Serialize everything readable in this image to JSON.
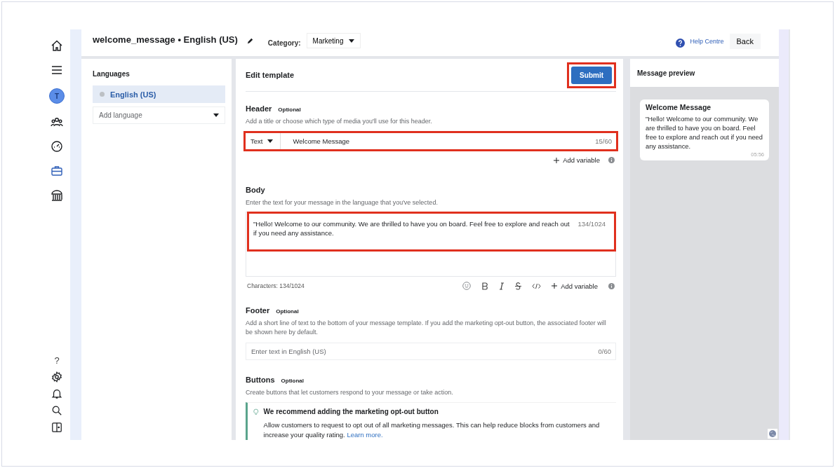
{
  "nav": {
    "top": [
      {
        "kind": "home",
        "selected": false
      },
      {
        "kind": "menu",
        "selected": false
      },
      {
        "kind": "avatar",
        "label": "T",
        "selected": false
      },
      {
        "kind": "people",
        "selected": false
      },
      {
        "kind": "gauge",
        "selected": false
      },
      {
        "kind": "briefcase",
        "selected": true
      },
      {
        "kind": "bank",
        "selected": false
      }
    ],
    "bottom": [
      {
        "kind": "help",
        "label": "?"
      },
      {
        "kind": "gear"
      },
      {
        "kind": "bell"
      },
      {
        "kind": "search"
      },
      {
        "kind": "panel"
      }
    ]
  },
  "header": {
    "title": "welcome_message • English (US)",
    "category_label": "Category:",
    "category_value": "Marketing",
    "help_link": "Help Centre",
    "back_button": "Back"
  },
  "languages": {
    "title": "Languages",
    "items": [
      {
        "label": "English (US)",
        "selected": true
      }
    ],
    "add_language": {
      "placeholder": "Add language"
    }
  },
  "editor": {
    "title": "Edit template",
    "submit": {
      "label": "Submit",
      "highlighted": true
    },
    "header_section": {
      "title": "Header",
      "optional": "Optional",
      "description": "Add a title or choose which type of media you'll use for this header.",
      "type_select": "Text",
      "value": "Welcome Message",
      "counter": "15/60",
      "highlighted": true,
      "add_variable": "Add variable"
    },
    "body_section": {
      "title": "Body",
      "description": "Enter the text for your message in the language that you've selected.",
      "value": "\"Hello! Welcome to our community. We are thrilled to have you on board. Feel free to explore and reach out if you need any assistance.",
      "counter": "134/1024",
      "highlighted": true,
      "characters": "Characters: 134/1024",
      "add_variable": "Add variable"
    },
    "footer_section": {
      "title": "Footer",
      "optional": "Optional",
      "description": "Add a short line of text to the bottom of your message template. If you add the marketing opt-out button, the associated footer will be shown here by default.",
      "placeholder": "Enter text in English (US)",
      "counter": "0/60"
    },
    "buttons_section": {
      "title": "Buttons",
      "optional": "Optional",
      "description": "Create buttons that let customers respond to your message or take action.",
      "tip": {
        "title": "We recommend adding the marketing opt-out button",
        "text": "Allow customers to request to opt out of all marketing messages. This can help reduce blocks from customers and increase your quality rating.",
        "link": "Learn more."
      }
    }
  },
  "preview": {
    "title": "Message preview",
    "bubble": {
      "title": "Welcome Message",
      "text": "\"Hello! Welcome to our community. We are thrilled to have you on board. Feel free to explore and reach out if you need any assistance.",
      "time": "05:56"
    }
  }
}
